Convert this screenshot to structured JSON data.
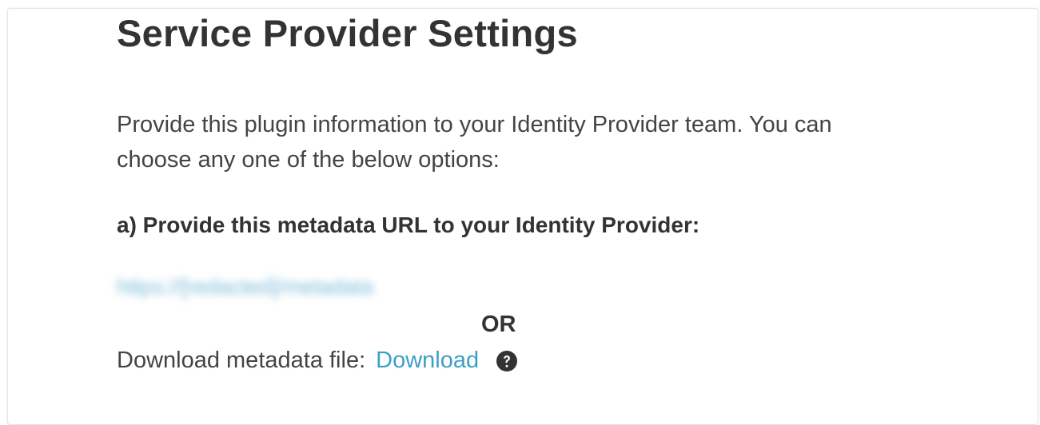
{
  "header": {
    "title": "Service Provider Settings"
  },
  "main": {
    "intro_text": "Provide this plugin information to your Identity Provider team. You can choose any one of the below options:",
    "option_a_label": "a) Provide this metadata URL to your Identity Provider:",
    "metadata_url": "https://[redacted]/metadata",
    "or_label": "OR",
    "download_label": "Download metadata file:",
    "download_link": "Download",
    "help_icon": "question-circle-icon"
  },
  "colors": {
    "link": "#3d9fc6",
    "heading": "#333333",
    "text": "#444444"
  }
}
